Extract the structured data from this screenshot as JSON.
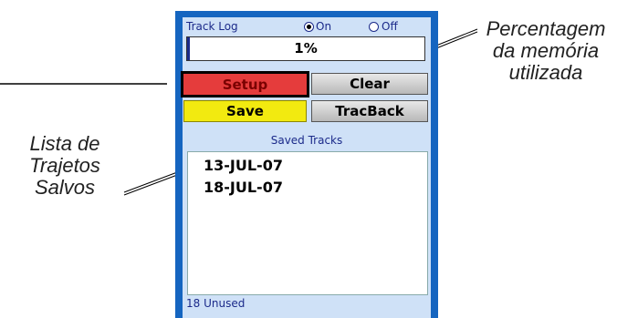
{
  "annotations": {
    "left": [
      "Lista de",
      "Trajetos",
      "Salvos"
    ],
    "right": [
      "Percentagem",
      "da memória",
      "utilizada"
    ]
  },
  "track_log": {
    "title": "Track Log",
    "on_label": "On",
    "off_label": "Off",
    "selected": "On",
    "memory_used_text": "1%",
    "memory_used_percent": 1
  },
  "buttons": {
    "setup": "Setup",
    "clear": "Clear",
    "save": "Save",
    "tracback": "TracBack"
  },
  "saved_tracks": {
    "title": "Saved Tracks",
    "items": [
      "13-JUL-07",
      "18-JUL-07"
    ],
    "footer": "18 Unused"
  },
  "colors": {
    "device_frame": "#1565c0",
    "screen_bg": "#cfe1f7",
    "setup_button": "#e53c3c",
    "save_button": "#f2ea10"
  }
}
